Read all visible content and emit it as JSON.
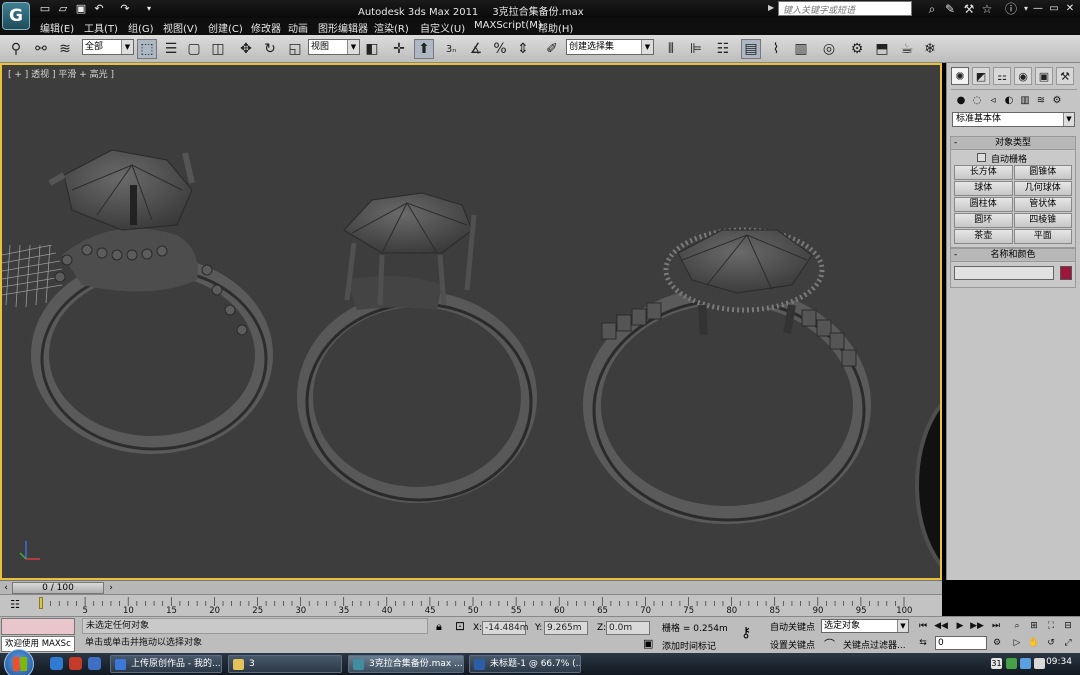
{
  "titlebar": {
    "app_name": "Autodesk 3ds Max  2011",
    "file_name": "3克拉合集备份.max",
    "search_placeholder": "键入关键字或短语"
  },
  "menu": [
    "编辑(E)",
    "工具(T)",
    "组(G)",
    "视图(V)",
    "创建(C)",
    "修改器",
    "动画",
    "图形编辑器",
    "渲染(R)",
    "自定义(U)",
    "MAXScript(M)",
    "帮助(H)"
  ],
  "toolbar": {
    "selection_filter": "全部",
    "reference_coord": "视图",
    "named_selection": "创建选择集",
    "snap_3": "3",
    "snap_2_5": "2.5"
  },
  "viewport": {
    "label": "[ + ] 透视 ] 平滑 + 高光 ]"
  },
  "command_panel": {
    "category": "标准基本体",
    "object_type_title": "对象类型",
    "autogrid_label": "自动栅格",
    "object_buttons": [
      "长方体",
      "圆锥体",
      "球体",
      "几何球体",
      "圆柱体",
      "管状体",
      "圆环",
      "四棱锥",
      "茶壶",
      "平面"
    ],
    "name_color_title": "名称和颜色",
    "object_color": "#a0153b"
  },
  "timeslider": {
    "position": "0 / 100",
    "current_frame": 0,
    "total_frames": 100
  },
  "trackbar": {
    "ticks": [
      "5",
      "10",
      "15",
      "20",
      "25",
      "30",
      "35",
      "40",
      "45",
      "50",
      "55",
      "60",
      "65",
      "70",
      "75",
      "80",
      "85",
      "90",
      "95",
      "100"
    ]
  },
  "status": {
    "maxscript_label": "欢迎使用 MAXSc",
    "selection_status": "未选定任何对象",
    "prompt": "单击或单击并拖动以选择对象",
    "x_value": "-14.484m",
    "y_value": "9.265m",
    "z_value": "0.0m",
    "grid_readout": "栅格 = 0.254m",
    "time_tag": "添加时间标记",
    "auto_key": "自动关键点",
    "set_key": "设置关键点",
    "selected_object": "选定对象",
    "key_filters": "关键点过滤器...",
    "frame": "0"
  },
  "taskbar": {
    "tasks": [
      "上传原创作品 - 我的...",
      "3",
      "3克拉合集备份.max ...",
      "未标题-1 @ 66.7% (..."
    ],
    "tray_date_badge": "31",
    "clock": "09:34"
  }
}
